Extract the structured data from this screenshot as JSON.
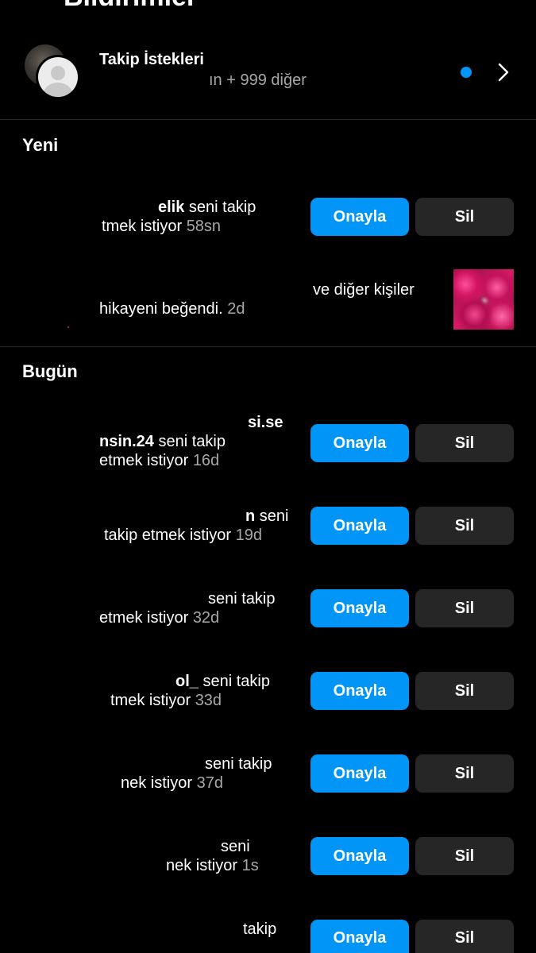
{
  "header": {
    "title": "Bildirimler"
  },
  "follow_requests": {
    "title": "Takip İstekleri",
    "subtitle": "ın + 999 diğer"
  },
  "sections": {
    "new_title": "Yeni",
    "today_title": "Bugün"
  },
  "new_items": {
    "req1": {
      "line1_bold": "elik",
      "line1_rest": " seni takip",
      "line2_text": "tmek istiyor",
      "time": "58sn"
    },
    "like": {
      "line1_text": "ve diğer kişiler",
      "line2_text": "hikayeni beğendi.",
      "time": "2d"
    }
  },
  "today_items": {
    "req1": {
      "line0_bold": "si.se",
      "line1_bold": "nsin.24",
      "line1_rest": " seni takip",
      "line2_text": "etmek istiyor",
      "time": "16d"
    },
    "req2": {
      "line1_bold": "n",
      "line1_rest": " seni",
      "line2_text": "takip etmek istiyor",
      "time": "19d"
    },
    "req3": {
      "line1_rest": "seni takip",
      "line2_text": "etmek istiyor",
      "time": "32d"
    },
    "req4": {
      "line1_bold": "ol_",
      "line1_rest": " seni takip",
      "line2_text": "tmek istiyor",
      "time": "33d"
    },
    "req5": {
      "line1_rest": "seni takip",
      "line2_text": "nek istiyor",
      "time": "37d"
    },
    "req6": {
      "line1_rest": "seni",
      "line2_text": "nek istiyor",
      "time": "1s"
    },
    "req7": {
      "line1_rest": "takip"
    }
  },
  "buttons": {
    "approve": "Onayla",
    "delete": "Sil"
  },
  "colors": {
    "accent": "#0095f6",
    "secondary_button": "#262626",
    "muted_text": "#a8a8a8"
  }
}
